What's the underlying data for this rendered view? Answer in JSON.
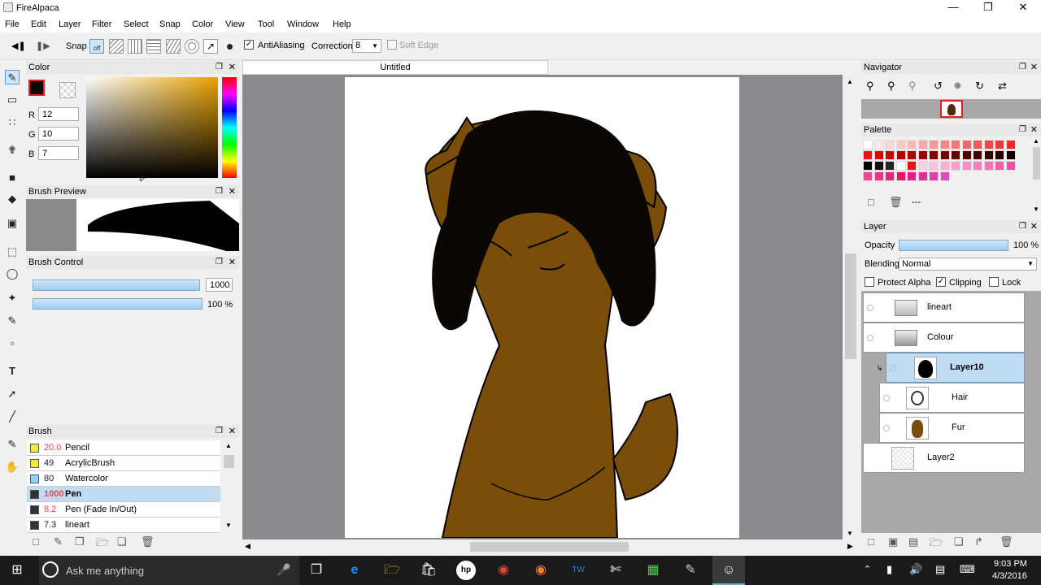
{
  "window": {
    "title": "FireAlpaca",
    "minimize_icon": "minimize-icon",
    "maximize_icon": "restore-icon",
    "close_icon": "close-icon"
  },
  "menu": [
    "File",
    "Edit",
    "Layer",
    "Filter",
    "Select",
    "Snap",
    "Color",
    "View",
    "Tool",
    "Window",
    "Help"
  ],
  "toolbar": {
    "snap": "Snap",
    "snap_off": "off",
    "antialiasing": "AntiAliasing",
    "correction": "Correction",
    "correction_value": "8",
    "soft_edge": "Soft Edge"
  },
  "color_panel": {
    "title": "Color",
    "r_label": "R",
    "r": "12",
    "g_label": "G",
    "g": "10",
    "b_label": "B",
    "b": "7"
  },
  "brush_preview": {
    "title": "Brush Preview"
  },
  "brush_control": {
    "title": "Brush Control",
    "size": "1000",
    "opacity": "100 %"
  },
  "brush_panel": {
    "title": "Brush",
    "items": [
      {
        "size": "20.0",
        "name": "Pencil",
        "color": "#f5e842"
      },
      {
        "size": "49",
        "name": "AcrylicBrush",
        "color": "#f5e842"
      },
      {
        "size": "80",
        "name": "Watercolor",
        "color": "#8fd3f5"
      },
      {
        "size": "1000",
        "name": "Pen",
        "color": "#333333",
        "selected": true
      },
      {
        "size": "8.2",
        "name": "Pen (Fade In/Out)",
        "color": "#333333"
      },
      {
        "size": "7.3",
        "name": "lineart",
        "color": "#333333"
      }
    ]
  },
  "document": {
    "tab": "Untitled"
  },
  "navigator": {
    "title": "Navigator"
  },
  "palette": {
    "title": "Palette",
    "dash": "---"
  },
  "layer_panel": {
    "title": "Layer",
    "opacity_label": "Opacity",
    "opacity": "100 %",
    "blending_label": "Blending",
    "blending": "Normal",
    "protect_alpha": "Protect Alpha",
    "clipping": "Clipping",
    "lock": "Lock",
    "layers": [
      {
        "name": "lineart",
        "type": "folder"
      },
      {
        "name": "Colour",
        "type": "folder"
      },
      {
        "name": "Layer10",
        "type": "layer",
        "selected": true
      },
      {
        "name": "Hair",
        "type": "layer"
      },
      {
        "name": "Fur",
        "type": "layer"
      },
      {
        "name": "Layer2",
        "type": "layer"
      }
    ]
  },
  "taskbar": {
    "search_placeholder": "Ask me anything",
    "time": "9:03 PM",
    "date": "4/3/2016"
  },
  "colors": {
    "accent": "#c0dcf3",
    "fur": "#7a4e09",
    "hair": "#0a0705"
  }
}
